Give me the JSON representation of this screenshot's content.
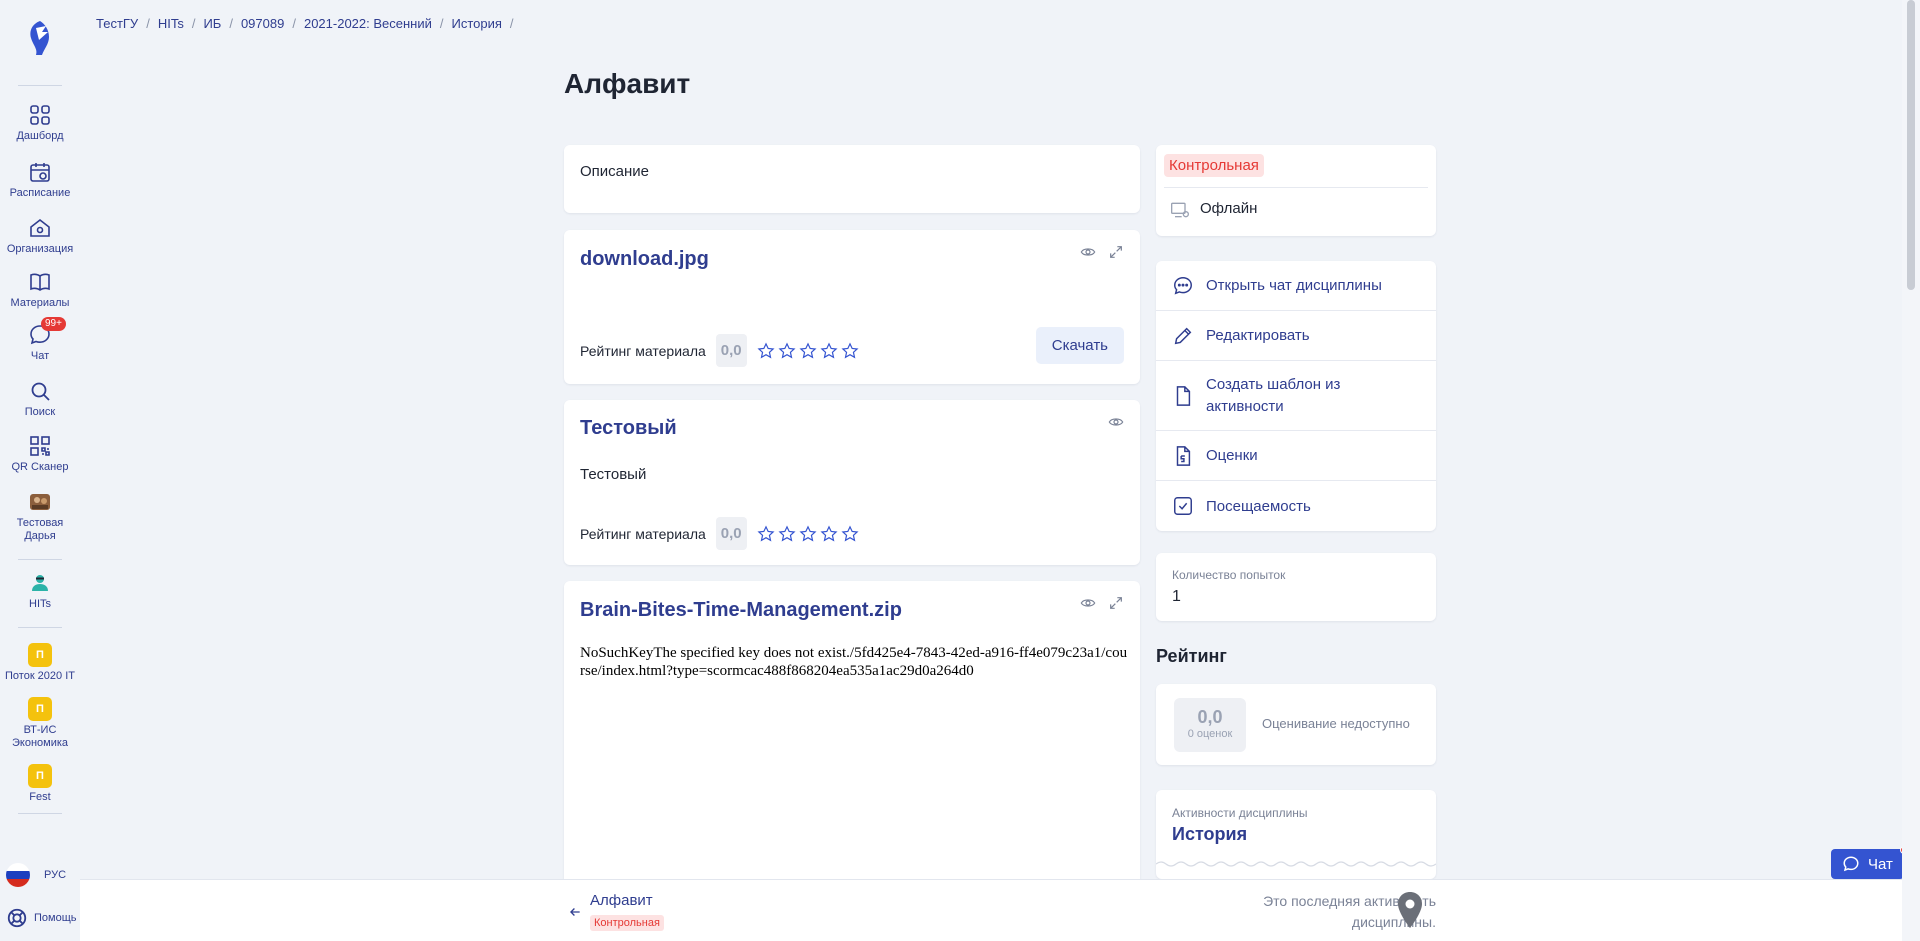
{
  "breadcrumb": [
    "ТестГУ",
    "HITs",
    "ИБ",
    "097089",
    "2021-2022: Весенний",
    "История"
  ],
  "page_title": "Алфавит",
  "sidebar": {
    "items": [
      {
        "label": "Дашборд",
        "icon": "grid-icon"
      },
      {
        "label": "Расписание",
        "icon": "calendar-icon"
      },
      {
        "label": "Организация",
        "icon": "organization-icon"
      },
      {
        "label": "Материалы",
        "icon": "book-icon"
      },
      {
        "label": "Чат",
        "icon": "chat-icon",
        "badge": "99+"
      },
      {
        "label": "Поиск",
        "icon": "search-icon"
      },
      {
        "label": "QR Сканер",
        "icon": "qr-icon"
      },
      {
        "label": "Тестовая Дарья",
        "icon": "avatar-icon"
      },
      {
        "label": "HITs",
        "icon": "hits-logo-icon"
      }
    ],
    "groups": [
      {
        "letter": "П",
        "label": "Поток 2020 IT"
      },
      {
        "letter": "П",
        "label": "ВТ-ИС Экономика"
      },
      {
        "letter": "П",
        "label": "Fest"
      }
    ],
    "language": "РУС",
    "help": "Помощь"
  },
  "description": {
    "label": "Описание"
  },
  "materials": [
    {
      "title": "download.jpg",
      "rating_label": "Рейтинг материала",
      "rating": "0,0",
      "download": "Скачать"
    },
    {
      "title": "Тестовый",
      "body": "Тестовый",
      "rating_label": "Рейтинг материала",
      "rating": "0,0"
    },
    {
      "title": "Brain-Bites-Time-Management.zip",
      "error_text": "NoSuchKeyThe specified key does not exist./5fd425e4-7843-42ed-a916-ff4e079c23a1/course/index.html?type=scormcac488f868204ea535a1ac29d0a264d0"
    }
  ],
  "info": {
    "type_tag": "Контрольная",
    "mode": "Офлайн"
  },
  "actions": [
    {
      "label": "Открыть чат дисциплины",
      "icon": "chat-bubble-icon"
    },
    {
      "label": "Редактировать",
      "icon": "pencil-icon"
    },
    {
      "label": "Создать шаблон из активности",
      "icon": "document-icon"
    },
    {
      "label": "Оценки",
      "icon": "grade-file-icon"
    },
    {
      "label": "Посещаемость",
      "icon": "checkbox-icon"
    }
  ],
  "attempts": {
    "label": "Количество попыток",
    "value": "1"
  },
  "rating": {
    "heading": "Рейтинг",
    "score": "0,0",
    "count": "0 оценок",
    "note": "Оценивание недоступно"
  },
  "discipline": {
    "label": "Активности дисциплины",
    "name": "История"
  },
  "bottom": {
    "title": "Алфавит",
    "tag": "Контрольная",
    "note_line1": "Это последняя активность",
    "note_line2": "дисциплины."
  },
  "chat_button": "Чат",
  "colors": {
    "accent": "#2f3d8f",
    "danger": "#e53935",
    "background": "#f0f3f8"
  }
}
